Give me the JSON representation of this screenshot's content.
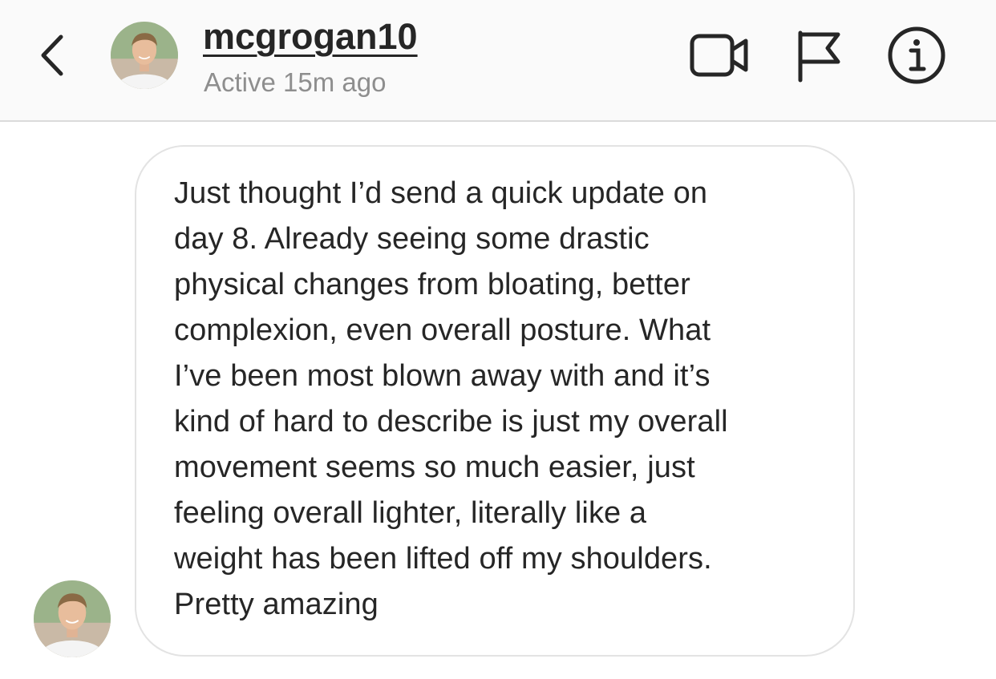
{
  "header": {
    "username": "mcgrogan10",
    "status": "Active 15m ago",
    "icons": {
      "back": "chevron-left-icon",
      "video": "video-camera-icon",
      "flag": "flag-icon",
      "info": "info-icon"
    }
  },
  "message": {
    "lines": [
      "Just thought I’d send a quick update on",
      "day 8. Already seeing some drastic",
      "physical changes from bloating, better",
      "complexion, even overall posture. What",
      "I’ve been most blown away with and it’s",
      "kind of hard to describe is just my overall",
      "movement seems so much easier, just",
      "feeling overall lighter, literally like a",
      "weight has been lifted off my shoulders.",
      "Pretty amazing"
    ]
  },
  "colors": {
    "header_bg": "#fafafa",
    "text": "#262626",
    "secondary_text": "#8e8e8e",
    "bubble_border": "#e3e3e3"
  }
}
